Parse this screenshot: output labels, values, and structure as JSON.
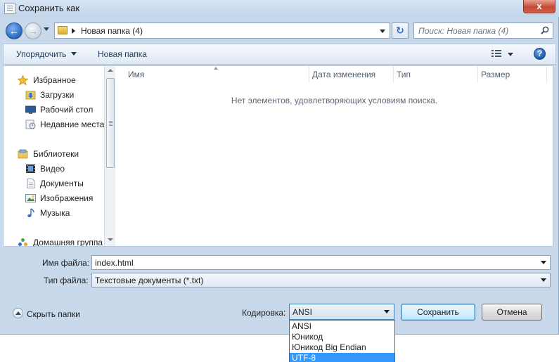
{
  "window": {
    "title": "Сохранить как",
    "close_label": "x"
  },
  "address": {
    "path": "Новая папка (4)",
    "search_placeholder": "Поиск: Новая папка (4)"
  },
  "toolbar": {
    "organize_label": "Упорядочить",
    "new_folder_label": "Новая папка",
    "help_label": "?"
  },
  "nav": {
    "favorites": "Избранное",
    "downloads": "Загрузки",
    "desktop": "Рабочий стол",
    "recent": "Недавние места",
    "libraries": "Библиотеки",
    "video": "Видео",
    "documents": "Документы",
    "images": "Изображения",
    "music": "Музыка",
    "homegroup": "Домашняя группа"
  },
  "columns": {
    "name": "Имя",
    "date": "Дата изменения",
    "type": "Тип",
    "size": "Размер"
  },
  "file_list": {
    "empty_message": "Нет элементов, удовлетворяющих условиям поиска."
  },
  "form": {
    "filename_label": "Имя файла:",
    "filename_value": "index.html",
    "filetype_label": "Тип файла:",
    "filetype_value": "Текстовые документы (*.txt)",
    "hide_folders_label": "Скрыть папки",
    "encoding_label": "Кодировка:",
    "encoding_value": "ANSI",
    "save_label": "Сохранить",
    "cancel_label": "Отмена"
  },
  "encoding_options": [
    "ANSI",
    "Юникод",
    "Юникод Big Endian",
    "UTF-8"
  ],
  "encoding_highlighted": "UTF-8",
  "colors": {
    "frame": "#c9d9ec",
    "highlight": "#3399ff",
    "close_button": "#c74a33"
  }
}
